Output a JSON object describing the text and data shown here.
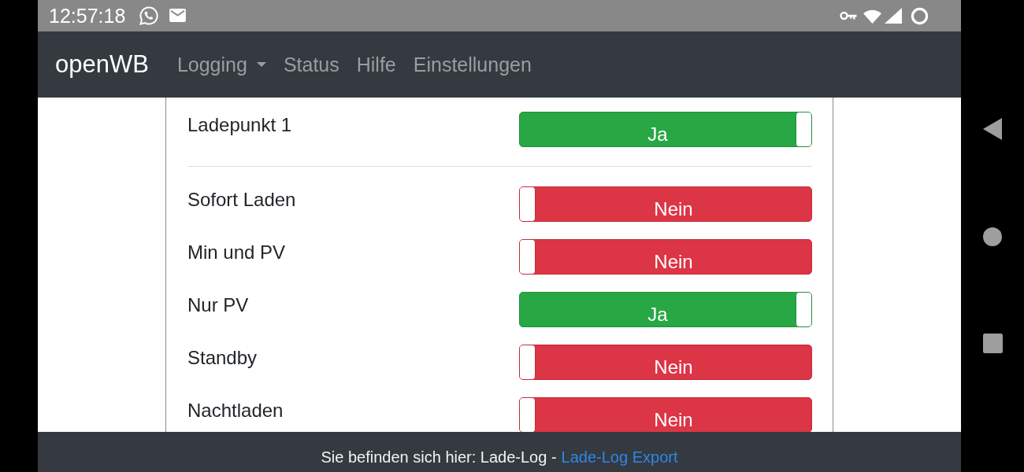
{
  "status_bar": {
    "time": "12:57:18"
  },
  "navbar": {
    "brand": "openWB",
    "items": [
      {
        "label": "Logging",
        "dropdown": true
      },
      {
        "label": "Status",
        "dropdown": false
      },
      {
        "label": "Hilfe",
        "dropdown": false
      },
      {
        "label": "Einstellungen",
        "dropdown": false
      }
    ]
  },
  "sections": [
    {
      "rows": [
        {
          "label": "Ladepunkt 1",
          "on": true,
          "value": "Ja"
        }
      ]
    },
    {
      "rows": [
        {
          "label": "Sofort Laden",
          "on": false,
          "value": "Nein"
        },
        {
          "label": "Min und PV",
          "on": false,
          "value": "Nein"
        },
        {
          "label": "Nur PV",
          "on": true,
          "value": "Ja"
        },
        {
          "label": "Standby",
          "on": false,
          "value": "Nein"
        },
        {
          "label": "Nachtladen",
          "on": false,
          "value": "Nein"
        }
      ]
    }
  ],
  "footer": {
    "text": "Sie befinden sich hier: Lade-Log -",
    "link": "Lade-Log Export"
  }
}
